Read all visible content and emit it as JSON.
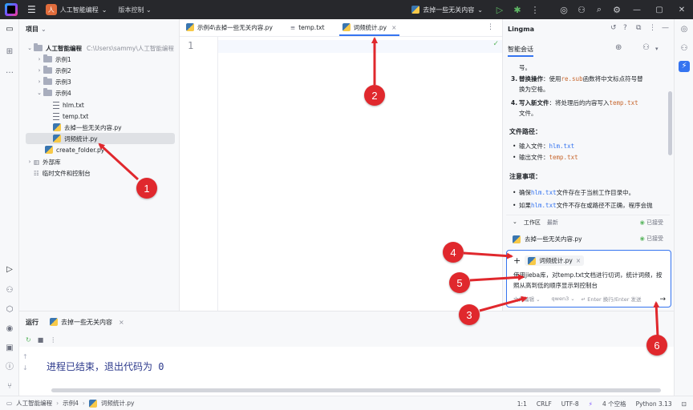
{
  "titlebar": {
    "menu_icon": "hamburger-icon",
    "project_badge": "人",
    "project_name": "人工智能编程",
    "vcs_label": "版本控制",
    "run_config": "去掉一些无关内容",
    "win_min": "—",
    "win_max": "▢",
    "win_close": "✕"
  },
  "project_panel": {
    "title": "项目",
    "tree": [
      {
        "label": "人工智能编程",
        "hint": "C:\\Users\\sammy\\人工智能编程",
        "kind": "folder",
        "depth": 0,
        "expanded": true
      },
      {
        "label": "示例1",
        "kind": "folder",
        "depth": 1,
        "expanded": false
      },
      {
        "label": "示例2",
        "kind": "folder",
        "depth": 1,
        "expanded": false
      },
      {
        "label": "示例3",
        "kind": "folder",
        "depth": 1,
        "expanded": false
      },
      {
        "label": "示例4",
        "kind": "folder",
        "depth": 1,
        "expanded": true
      },
      {
        "label": "hlm.txt",
        "kind": "txt",
        "depth": 2
      },
      {
        "label": "temp.txt",
        "kind": "txt",
        "depth": 2
      },
      {
        "label": "去掉一些无关内容.py",
        "kind": "py",
        "depth": 2
      },
      {
        "label": "词频统计.py",
        "kind": "py",
        "depth": 2,
        "selected": true
      },
      {
        "label": "create_folder.py",
        "kind": "py",
        "depth": 1
      },
      {
        "label": "外部库",
        "kind": "lib",
        "depth": 0,
        "expanded": false
      },
      {
        "label": "临时文件和控制台",
        "kind": "scratch",
        "depth": 0
      }
    ]
  },
  "editor": {
    "tabs": [
      {
        "label": "示例4\\去掉一些无关内容.py",
        "active": false
      },
      {
        "label": "temp.txt",
        "active": false
      },
      {
        "label": "词频统计.py",
        "active": true
      }
    ],
    "line_number": "1"
  },
  "ai_panel": {
    "title": "Lingma",
    "subtab": "智能会话",
    "content": {
      "line_top": "号。",
      "item3_num": "3.",
      "item3_bold": "替换操作",
      "item3_a": "：使用",
      "item3_code": "re.sub",
      "item3_b": "函数将中文标点符号替",
      "item3_c": "换为空格。",
      "item4_num": "4.",
      "item4_bold": "写入新文件",
      "item4_a": "：将处理后的内容写入",
      "item4_code": "temp.txt",
      "item4_b": "文件。",
      "path_heading": "文件路径：",
      "input_label": "输入文件：",
      "input_file": "hlm.txt",
      "output_label": "输出文件：",
      "output_file": "temp.txt",
      "notes_heading": "注意事项：",
      "note1_a": "确保",
      "note1_code": "hlm.txt",
      "note1_b": "文件存在于当前工作目录中。",
      "note2_a": "如果",
      "note2_code": "hlm.txt",
      "note2_b": "文件不存在或路径不正确，程序会抛"
    },
    "workarea": {
      "label": "工作区",
      "latest": "最新",
      "accepted_1": "已接受",
      "file": "去掉一些无关内容.py",
      "accepted_2": "已接受"
    },
    "input": {
      "add": "+",
      "context_file": "词频统计.py",
      "text": "使用jieba库，对temp.txt文档进行切词，统计词频，按照从高到低的顺序显示到控制台",
      "mode": "文件编辑",
      "model": "qwen3",
      "hint": "↵ Enter 换行/Enter 发送",
      "send": "→"
    }
  },
  "run_panel": {
    "title": "运行",
    "tab": "去掉一些无关内容",
    "output": "进程已结束，退出代码为 0"
  },
  "statusbar": {
    "crumbs": [
      "人工智能编程",
      "示例4",
      "词频统计.py"
    ],
    "position": "1:1",
    "line_sep": "CRLF",
    "encoding": "UTF-8",
    "indent": "4 个空格",
    "interpreter": "Python 3.13"
  },
  "annotations": [
    "1",
    "2",
    "3",
    "4",
    "5",
    "6"
  ],
  "colors": {
    "annotation": "#e0282d",
    "accent": "#3574f0",
    "titlebar": "#27282c"
  }
}
